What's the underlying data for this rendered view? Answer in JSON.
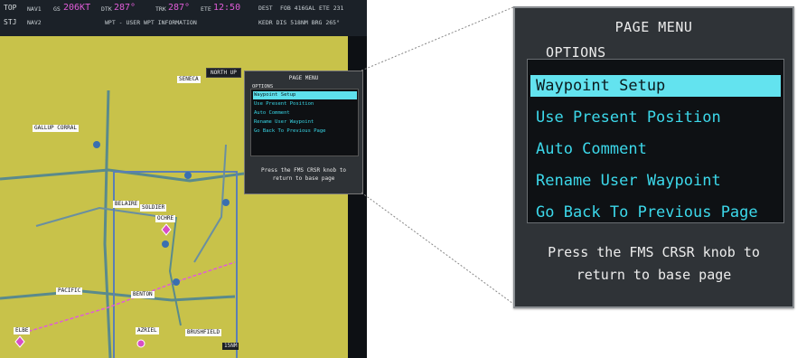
{
  "navbar": {
    "top_left": "TOP",
    "nav1_label": "NAV1",
    "gs_label": "GS",
    "gs_value": "206KT",
    "dtk_label": "DTK",
    "dtk_value": "287°",
    "trk_label": "TRK",
    "trk_value": "287°",
    "ete_label": "ETE",
    "ete_value": "12:50",
    "dest_label": "DEST",
    "dest_line1": "FOB 416GAL ETE 231",
    "stj": "STJ",
    "nav2_label": "NAV2",
    "page_title": "WPT - USER WPT INFORMATION",
    "dest_line2": "KEDR DIS 518NM BRG 265°"
  },
  "map": {
    "north_up": "NORTH UP",
    "range": "15NM",
    "labels": [
      "SENECA",
      "GALLUP CORRAL",
      "BELAIRE",
      "SOLDIER",
      "OCHRE",
      "BENTON",
      "ELBE",
      "PACIFIC",
      "AZRIEL",
      "BRUSHFIELD"
    ]
  },
  "mini_menu": {
    "title": "PAGE MENU",
    "options_label": "OPTIONS",
    "items": [
      "Waypoint Setup",
      "Use Present Position",
      "Auto Comment",
      "Rename User Waypoint",
      "Go Back To Previous Page"
    ],
    "footer_line1": "Press the FMS CRSR knob to",
    "footer_line2": "return to base page"
  },
  "page_menu": {
    "title": "PAGE MENU",
    "options_label": "OPTIONS",
    "items": [
      "Waypoint Setup",
      "Use Present Position",
      "Auto Comment",
      "Rename User Waypoint",
      "Go Back To Previous Page"
    ],
    "selected_index": 0,
    "footer_line1": "Press the FMS CRSR knob to",
    "footer_line2": "return to base page"
  },
  "colors": {
    "item_text": "#3cd8ea",
    "selected_bg": "#63e3ef",
    "map_bg": "#c8c24a",
    "route": "#e05cd8"
  }
}
